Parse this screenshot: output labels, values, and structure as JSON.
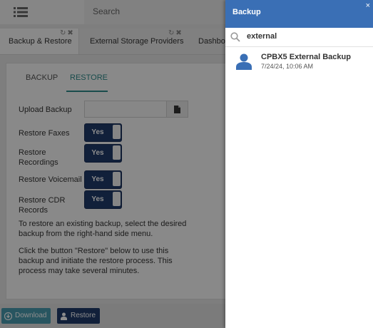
{
  "topbar": {
    "search_placeholder": "Search"
  },
  "tabs": [
    {
      "label": "Backup & Restore",
      "active": true
    },
    {
      "label": "External Storage Providers",
      "active": false
    },
    {
      "label": "Dashbo",
      "active": false
    }
  ],
  "subtabs": [
    {
      "label": "BACKUP",
      "active": false
    },
    {
      "label": "RESTORE",
      "active": true
    }
  ],
  "form": {
    "upload_label": "Upload Backup",
    "rows": [
      {
        "label": "Restore Faxes",
        "value": "Yes"
      },
      {
        "label": "Restore Recordings",
        "value": "Yes"
      },
      {
        "label": "Restore Voicemail",
        "value": "Yes"
      },
      {
        "label": "Restore CDR Records",
        "value": "Yes"
      }
    ],
    "help_1": "To restore an existing backup, select the desired backup from the right-hand side menu.",
    "help_2": "Click the button \"Restore\" below to use this backup and initiate the restore process. This process may take several minutes."
  },
  "footer": {
    "download_label": "Download",
    "restore_label": "Restore"
  },
  "drawer": {
    "title": "Backup",
    "close_glyph": "×",
    "search_value": "external",
    "items": [
      {
        "name": "CPBX5 External Backup",
        "date": "7/24/24, 10:06 AM"
      }
    ]
  },
  "colors": {
    "accent_blue": "#3a6fb5",
    "toggle_navy": "#1f3b6b",
    "teal": "#2e8b8b",
    "download_blue": "#4a9bb0"
  },
  "icons": [
    "list-icon",
    "refresh-icon",
    "close-icon",
    "file-icon",
    "download-icon",
    "restore-icon",
    "search-icon",
    "user-icon"
  ]
}
